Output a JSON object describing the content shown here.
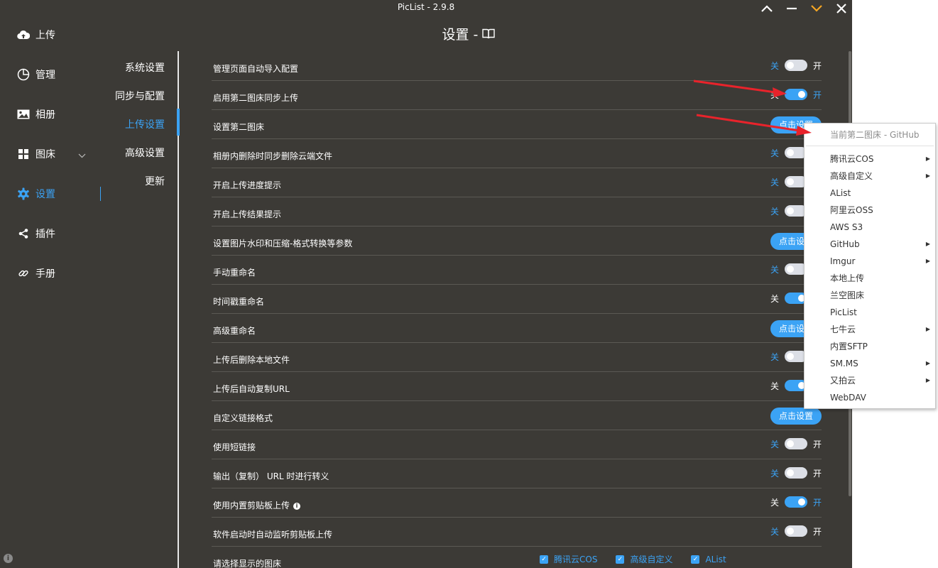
{
  "window": {
    "title": "PicList - 2.9.8",
    "controls": [
      "chevron-up-icon",
      "minimize-icon",
      "chevron-down-icon",
      "close-icon"
    ],
    "pin_color": "#f5a623"
  },
  "sidebar": {
    "items": [
      {
        "label": "上传",
        "icon": "cloud-upload-icon"
      },
      {
        "label": "管理",
        "icon": "pie-chart-icon"
      },
      {
        "label": "相册",
        "icon": "picture-icon"
      },
      {
        "label": "图床",
        "icon": "grid-icon"
      },
      {
        "label": "设置",
        "icon": "gear-icon"
      },
      {
        "label": "插件",
        "icon": "share-icon"
      },
      {
        "label": "手册",
        "icon": "link-icon"
      }
    ],
    "active": "设置",
    "accent_color": "#3ba3f5"
  },
  "page": {
    "title": "设置 -",
    "title_icon": "book-icon"
  },
  "subnav": {
    "items": [
      "系统设置",
      "同步与配置",
      "上传设置",
      "高级设置",
      "更新"
    ],
    "active": "上传设置"
  },
  "settings": {
    "off_label": "关",
    "on_label": "开",
    "button_label": "点击设置",
    "rows": [
      {
        "label": "管理页面自动导入配置",
        "type": "switch",
        "on": false
      },
      {
        "label": "启用第二图床同步上传",
        "type": "switch",
        "on": true
      },
      {
        "label": "设置第二图床",
        "type": "button"
      },
      {
        "label": "相册内删除时同步删除云端文件",
        "type": "switch",
        "on": false
      },
      {
        "label": "开启上传进度提示",
        "type": "switch",
        "on": false
      },
      {
        "label": "开启上传结果提示",
        "type": "switch",
        "on": false
      },
      {
        "label": "设置图片水印和压缩-格式转换等参数",
        "type": "button"
      },
      {
        "label": "手动重命名",
        "type": "switch",
        "on": false
      },
      {
        "label": "时间戳重命名",
        "type": "switch",
        "on": true
      },
      {
        "label": "高级重命名",
        "type": "button"
      },
      {
        "label": "上传后删除本地文件",
        "type": "switch",
        "on": false
      },
      {
        "label": "上传后自动复制URL",
        "type": "switch",
        "on": true
      },
      {
        "label": "自定义链接格式",
        "type": "button"
      },
      {
        "label": "使用短链接",
        "type": "switch",
        "on": false
      },
      {
        "label": "输出（复制） URL 时进行转义",
        "type": "switch",
        "on": false
      },
      {
        "label": "使用内置剪贴板上传",
        "type": "switch",
        "on": true,
        "info": "i"
      },
      {
        "label": "软件启动时自动监听剪贴板上传",
        "type": "switch",
        "on": false
      },
      {
        "label": "请选择显示的图床",
        "type": "checkboxes",
        "options": [
          "腾讯云COS",
          "高级自定义",
          "AList"
        ]
      }
    ]
  },
  "context_menu": {
    "header": "当前第二图床 - GitHub",
    "items": [
      {
        "label": "腾讯云COS",
        "submenu": true
      },
      {
        "label": "高级自定义",
        "submenu": true
      },
      {
        "label": "AList",
        "submenu": false
      },
      {
        "label": "阿里云OSS",
        "submenu": false
      },
      {
        "label": "AWS S3",
        "submenu": false
      },
      {
        "label": "GitHub",
        "submenu": true
      },
      {
        "label": "Imgur",
        "submenu": true
      },
      {
        "label": "本地上传",
        "submenu": false
      },
      {
        "label": "兰空图床",
        "submenu": false
      },
      {
        "label": "PicList",
        "submenu": false
      },
      {
        "label": "七牛云",
        "submenu": true
      },
      {
        "label": "内置SFTP",
        "submenu": false
      },
      {
        "label": "SM.MS",
        "submenu": true
      },
      {
        "label": "又拍云",
        "submenu": true
      },
      {
        "label": "WebDAV",
        "submenu": false
      }
    ],
    "arrow_glyph": "▶"
  },
  "annotation": {
    "arrow_color": "#e8232b"
  }
}
